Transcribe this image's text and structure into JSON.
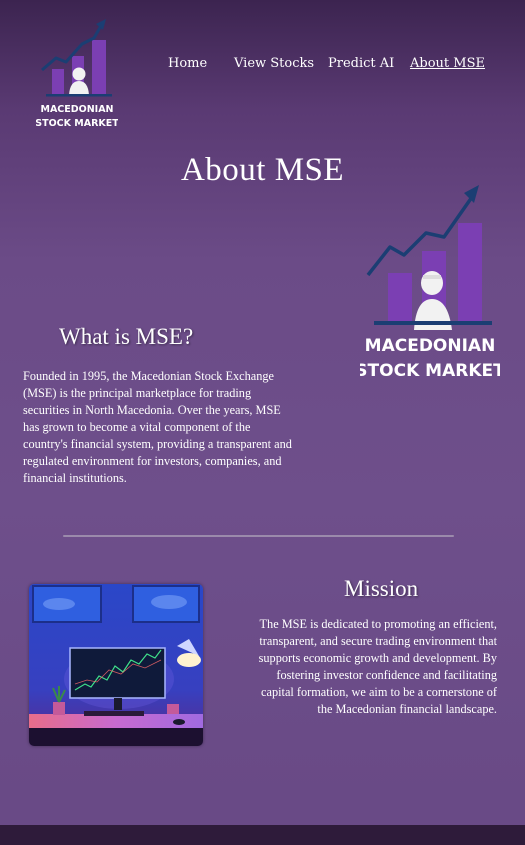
{
  "header": {
    "logo_line1": "MACEDONIAN",
    "logo_line2": "STOCK MARKET"
  },
  "nav": {
    "items": [
      {
        "label": "Home"
      },
      {
        "label": "View Stocks"
      },
      {
        "label": "Predict AI"
      },
      {
        "label": "About MSE",
        "active": true
      }
    ]
  },
  "page": {
    "title": "About MSE"
  },
  "about": {
    "heading": "What is MSE?",
    "lines": [
      "Founded in 1995, the Macedonian Stock Exchange",
      "(MSE) is the principal marketplace for trading",
      "securities in North Macedonia. Over the years, MSE",
      "has grown to become a vital component of the",
      "country's financial system, providing a transparent and",
      "regulated environment for investors, companies, and",
      "financial institutions."
    ]
  },
  "brand_logo": {
    "line1": "MACEDONIAN",
    "line2": "STOCK MARKET"
  },
  "mission": {
    "heading": "Mission",
    "lines": [
      "The MSE is dedicated to promoting an efficient,",
      "transparent, and secure trading environment that",
      "supports economic growth and development. By",
      "fostering investor confidence and facilitating",
      "capital formation, we aim to be a cornerstone of",
      "the Macedonian financial landscape."
    ]
  },
  "colors": {
    "accent_bar": "#7b3fb3",
    "logo_navy": "#1b3e73"
  }
}
